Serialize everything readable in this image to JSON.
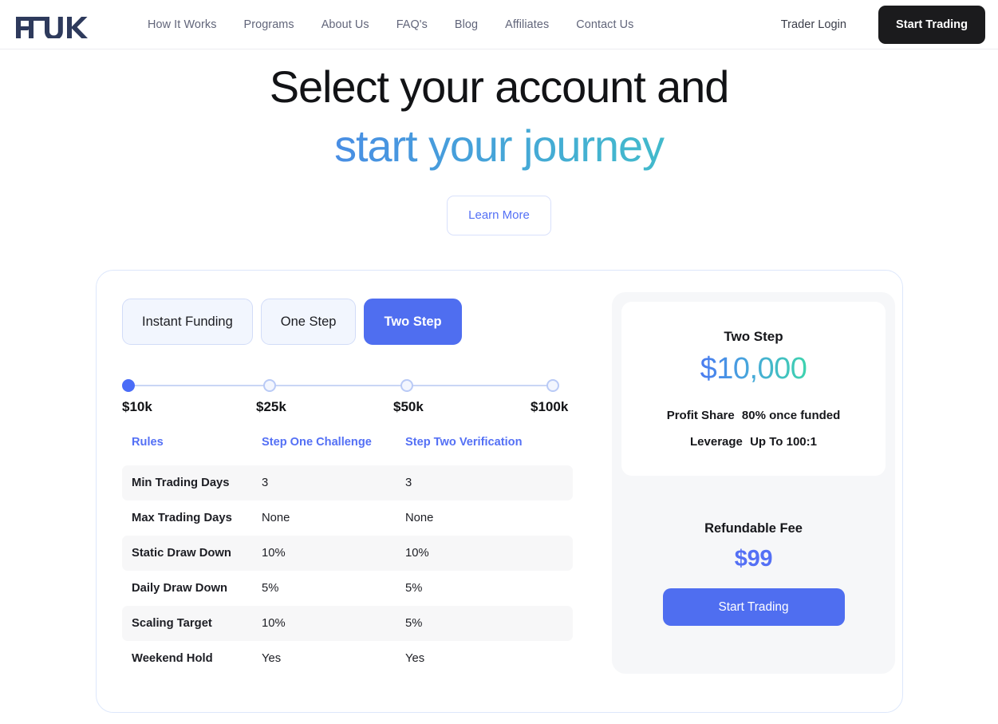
{
  "header": {
    "logo_text": "FTUK",
    "nav": [
      {
        "label": "How It Works"
      },
      {
        "label": "Programs"
      },
      {
        "label": "About Us"
      },
      {
        "label": "FAQ's"
      },
      {
        "label": "Blog"
      },
      {
        "label": "Affiliates"
      },
      {
        "label": "Contact Us"
      }
    ],
    "trader_login": "Trader Login",
    "start_trading": "Start Trading"
  },
  "hero": {
    "line1": "Select your account and",
    "line2": "start your journey",
    "learn_more": "Learn More"
  },
  "tabs": [
    {
      "label": "Instant Funding",
      "active": false
    },
    {
      "label": "One Step",
      "active": false
    },
    {
      "label": "Two Step",
      "active": true
    }
  ],
  "slider": {
    "selected_index": 0,
    "options": [
      {
        "label": "$10k"
      },
      {
        "label": "$25k"
      },
      {
        "label": "$50k"
      },
      {
        "label": "$100k"
      }
    ]
  },
  "table": {
    "headers": [
      "Rules",
      "Step One Challenge",
      "Step Two Verification"
    ],
    "rows": [
      {
        "rule": "Min Trading Days",
        "step_one": "3",
        "step_two": "3"
      },
      {
        "rule": "Max Trading Days",
        "step_one": "None",
        "step_two": "None"
      },
      {
        "rule": "Static Draw Down",
        "step_one": "10%",
        "step_two": "10%"
      },
      {
        "rule": "Daily Draw Down",
        "step_one": "5%",
        "step_two": "5%"
      },
      {
        "rule": "Scaling Target",
        "step_one": "10%",
        "step_two": "5%"
      },
      {
        "rule": "Weekend Hold",
        "step_one": "Yes",
        "step_two": "Yes"
      }
    ]
  },
  "plan": {
    "name": "Two Step",
    "amount": "$10,000",
    "profit_share_label": "Profit Share",
    "profit_share_value": "80% once funded",
    "leverage_label": "Leverage",
    "leverage_value": "Up To 100:1",
    "fee_label": "Refundable Fee",
    "fee_amount": "$99",
    "cta": "Start Trading"
  },
  "colors": {
    "accent_blue": "#4F6EF0",
    "link_blue": "#5470F5",
    "gradient_start": "#4466F0",
    "gradient_end": "#3ED2B0",
    "logo_navy": "#2E3A5C",
    "dark_button": "#1B1B1D",
    "row_alt": "#F7F7F8",
    "panel_bg": "#F6F7F9"
  }
}
